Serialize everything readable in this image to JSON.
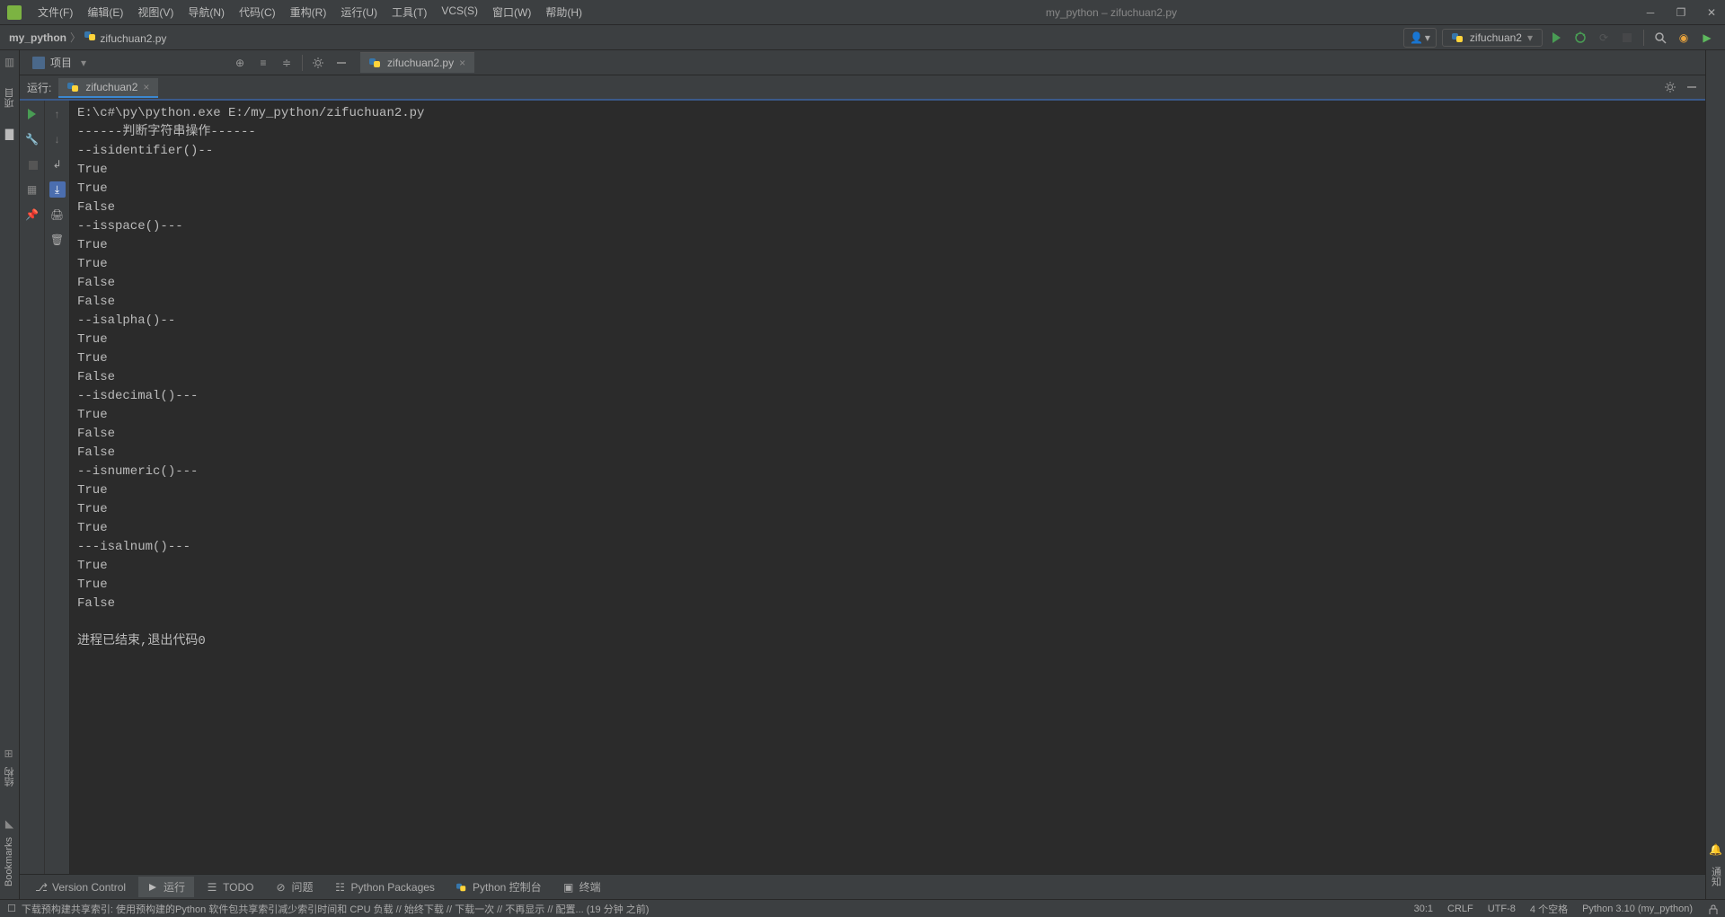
{
  "window": {
    "title": "my_python – zifuchuan2.py"
  },
  "menu": {
    "file": "文件(F)",
    "edit": "编辑(E)",
    "view": "视图(V)",
    "navigate": "导航(N)",
    "code": "代码(C)",
    "refactor": "重构(R)",
    "run": "运行(U)",
    "tools": "工具(T)",
    "vcs": "VCS(S)",
    "window": "窗口(W)",
    "help": "帮助(H)"
  },
  "breadcrumb": {
    "project": "my_python",
    "file": "zifuchuan2.py"
  },
  "run_config": {
    "name": "zifuchuan2"
  },
  "project_tool": {
    "label": "项目"
  },
  "editor_tab": {
    "name": "zifuchuan2.py"
  },
  "left_tools": {
    "project": "项目",
    "structure": "结构",
    "bookmarks": "Bookmarks"
  },
  "right_tools": {
    "notifications": "通知"
  },
  "run_panel": {
    "label": "运行:",
    "tab": "zifuchuan2"
  },
  "console_output": "E:\\c#\\py\\python.exe E:/my_python/zifuchuan2.py\n------判断字符串操作------\n--isidentifier()--\nTrue\nTrue\nFalse\n--isspace()---\nTrue\nTrue\nFalse\nFalse\n--isalpha()--\nTrue\nTrue\nFalse\n--isdecimal()---\nTrue\nFalse\nFalse\n--isnumeric()---\nTrue\nTrue\nTrue\n---isalnum()---\nTrue\nTrue\nFalse\n\n进程已结束,退出代码0\n",
  "bottom_tabs": {
    "version_control": "Version Control",
    "run": "运行",
    "todo": "TODO",
    "problems": "问题",
    "packages": "Python Packages",
    "python_console": "Python 控制台",
    "terminal": "终端"
  },
  "status": {
    "message": "下载预构建共享索引: 使用预构建的Python 软件包共享索引减少索引时间和 CPU 负载 // 始终下载 // 下载一次 // 不再显示 // 配置... (19 分钟 之前)",
    "position": "30:1",
    "line_sep": "CRLF",
    "encoding": "UTF-8",
    "indent": "4 个空格",
    "interpreter": "Python 3.10 (my_python)"
  }
}
